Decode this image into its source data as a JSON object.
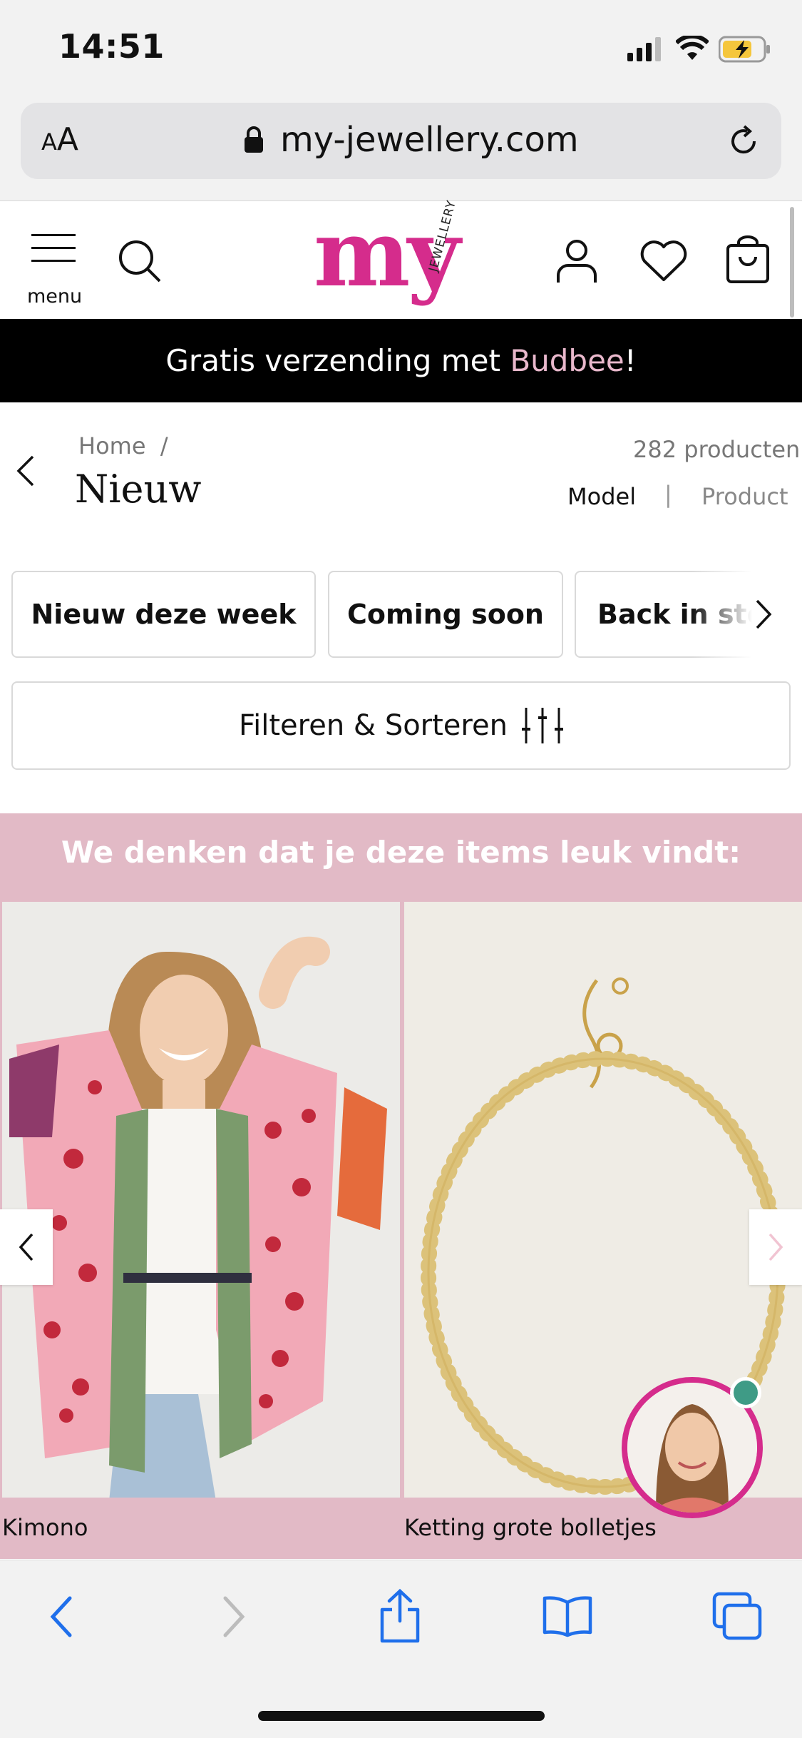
{
  "status": {
    "time": "14:51"
  },
  "browser": {
    "text_size_label_small": "A",
    "text_size_label_large": "A",
    "url": "my-jewellery.com"
  },
  "header": {
    "menu_label": "menu",
    "logo_text": "my",
    "logo_subtext": "JEWELLERY",
    "brand_color": "#d52c8c"
  },
  "banner": {
    "text_before": "Gratis verzending met ",
    "accent": "Budbee",
    "text_after": "!"
  },
  "page": {
    "breadcrumb": "Home  /",
    "title": "Nieuw",
    "product_count": "282 producten",
    "view_model": "Model",
    "view_separator": "|",
    "view_product": "Product"
  },
  "chips": [
    "Nieuw deze week",
    "Coming soon",
    "Back in stock"
  ],
  "filter": {
    "label": "Filteren & Sorteren"
  },
  "recommendations": {
    "title": "We denken dat je deze items leuk vindt:",
    "items": [
      {
        "name": "Kimono"
      },
      {
        "name": "Ketting grote bolletjes"
      }
    ]
  },
  "toolbar": {
    "icons": [
      "back-icon",
      "forward-icon",
      "share-icon",
      "bookmarks-icon",
      "tabs-icon"
    ]
  }
}
